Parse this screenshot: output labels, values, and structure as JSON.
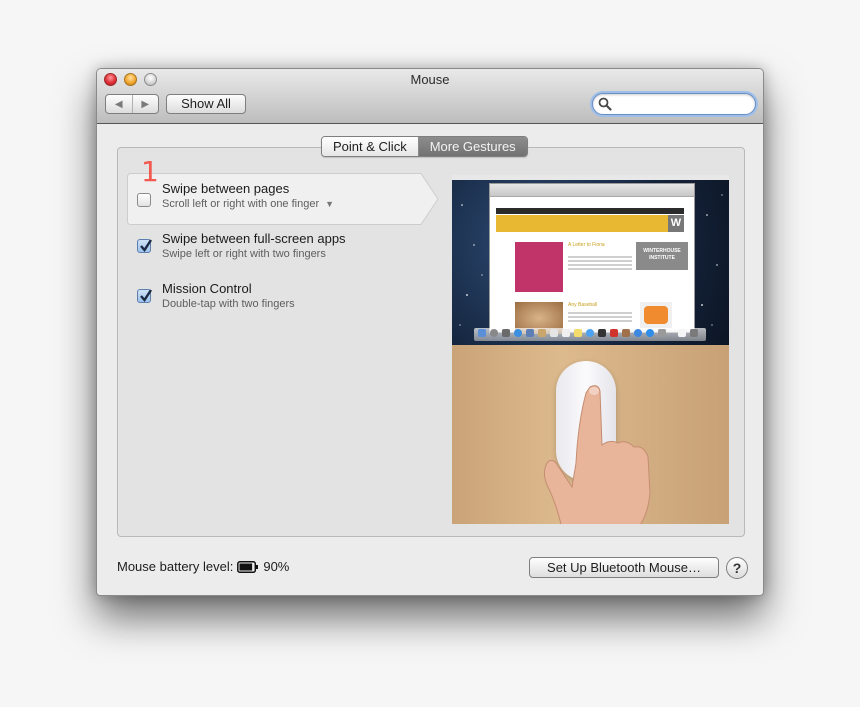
{
  "window": {
    "title": "Mouse",
    "traffic_lights": [
      "close",
      "minimize",
      "zoom"
    ]
  },
  "toolbar": {
    "back_icon": "triangle-left",
    "forward_icon": "triangle-right",
    "show_all_label": "Show All",
    "search": {
      "placeholder": "",
      "value": "",
      "icon": "magnifier-icon"
    }
  },
  "tabs": [
    {
      "label": "Point & Click",
      "selected": false
    },
    {
      "label": "More Gestures",
      "selected": true
    }
  ],
  "annotation": {
    "number": "1",
    "color": "#f2594f"
  },
  "gestures": [
    {
      "title": "Swipe between pages",
      "subtitle": "Scroll left or right with one finger",
      "checked": false,
      "selected": true,
      "has_dropdown": true
    },
    {
      "title": "Swipe between full-screen apps",
      "subtitle": "Swipe left or right with two fingers",
      "checked": true,
      "selected": false,
      "has_dropdown": false
    },
    {
      "title": "Mission Control",
      "subtitle": "Double-tap with two fingers",
      "checked": true,
      "selected": false,
      "has_dropdown": false
    }
  ],
  "preview": {
    "description": "Demo video: desktop with browser showing Design Observer site, hand swiping on Magic Mouse",
    "browser_banner_letter": "W",
    "winterhouse_text": "WINTERHOUSE INSTITUTE",
    "headline_1": "A Letter to Fiona on First Reading \"The End of Print\"",
    "headline_2": "Any Baseball is Beautiful"
  },
  "footer": {
    "battery_label": "Mouse battery level:",
    "battery_icon": "battery-icon",
    "battery_percent": "90%",
    "battery_level": 0.9,
    "bluetooth_button": "Set Up Bluetooth Mouse…",
    "help_button": "?"
  }
}
